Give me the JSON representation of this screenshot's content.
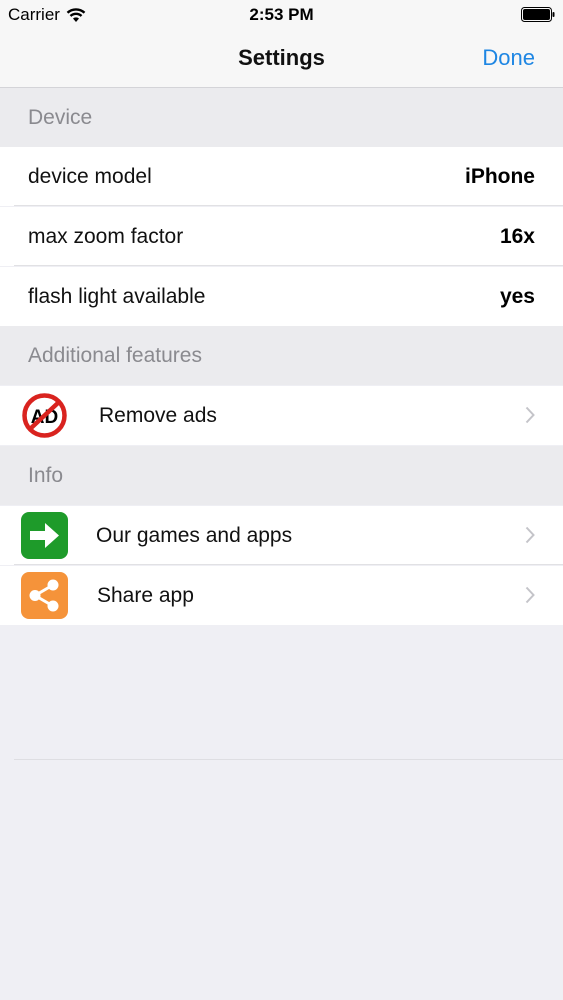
{
  "status": {
    "carrier": "Carrier",
    "time": "2:53 PM"
  },
  "nav": {
    "title": "Settings",
    "done": "Done"
  },
  "sections": {
    "device": {
      "header": "Device",
      "rows": [
        {
          "label": "device model",
          "value": "iPhone"
        },
        {
          "label": "max zoom factor",
          "value": "16x"
        },
        {
          "label": "flash light available",
          "value": "yes"
        }
      ]
    },
    "additional": {
      "header": "Additional features",
      "rows": [
        {
          "label": "Remove ads",
          "icon": "no-ads-icon",
          "icon_text": "AD"
        }
      ]
    },
    "info": {
      "header": "Info",
      "rows": [
        {
          "label": "Our games and apps",
          "icon": "arrow-right-icon"
        },
        {
          "label": "Share app",
          "icon": "share-icon"
        }
      ]
    }
  },
  "colors": {
    "accent": "#1e86e3",
    "no_ads_red": "#d9231f",
    "games_green": "#1e9b2a",
    "share_orange": "#f5933a"
  }
}
